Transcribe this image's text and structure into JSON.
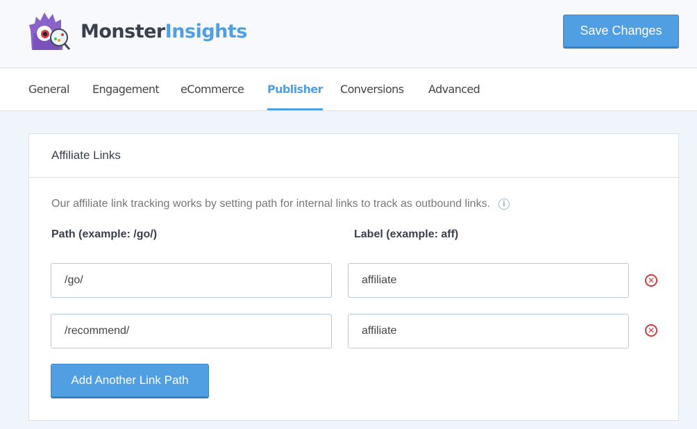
{
  "header": {
    "logo_monster": "Monster",
    "logo_insights": "Insights",
    "save_label": "Save Changes"
  },
  "tabs": [
    {
      "label": "General",
      "active": false
    },
    {
      "label": "Engagement",
      "active": false
    },
    {
      "label": "eCommerce",
      "active": false
    },
    {
      "label": "Publisher",
      "active": true
    },
    {
      "label": "Conversions",
      "active": false
    },
    {
      "label": "Advanced",
      "active": false
    }
  ],
  "panel": {
    "title": "Affiliate Links",
    "description": "Our affiliate link tracking works by setting path for internal links to track as outbound links.",
    "info_icon": "i",
    "path_label": "Path (example: /go/)",
    "label_label": "Label (example: aff)",
    "rows": [
      {
        "path": "/go/",
        "label": "affiliate"
      },
      {
        "path": "/recommend/",
        "label": "affiliate"
      }
    ],
    "remove_icon": "✕",
    "add_label": "Add Another Link Path"
  },
  "colors": {
    "accent": "#509fe2",
    "danger": "#d4393b"
  }
}
